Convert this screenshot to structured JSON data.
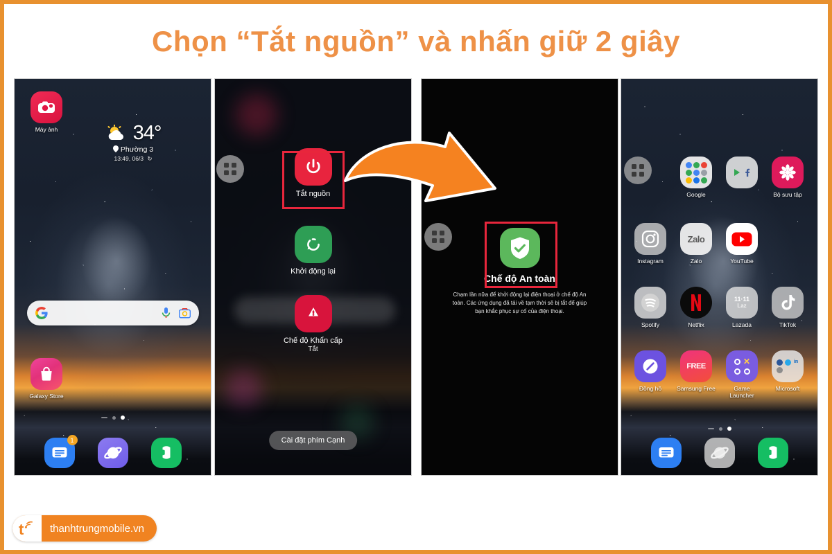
{
  "page": {
    "title": "Chọn “Tắt nguồn” và nhấn giữ 2 giây",
    "accent_color": "#EE9147",
    "frame_color": "#E8912F",
    "highlight_color": "#E8263C"
  },
  "watermark": {
    "text": "thanhtrungmobile.vn",
    "logo_letter": "t"
  },
  "arrow": {
    "name": "curved-arrow",
    "color": "#F58220",
    "outline": "#FFFFFF",
    "direction": "right-down"
  },
  "phone1": {
    "apps": [
      {
        "label": "Máy ảnh",
        "icon": "camera-icon"
      },
      {
        "label": "Galaxy Store",
        "icon": "galaxy-store-icon"
      }
    ],
    "weather": {
      "temperature": "34°",
      "place": "Phường 3",
      "time": "13:49, 06/3",
      "condition": "partly-cloudy"
    },
    "search": {
      "placeholder": "",
      "value": "",
      "engine": "google-icon",
      "mic": "microphone-icon",
      "lens": "camera-lens-icon"
    },
    "dock": [
      {
        "label": "Messages",
        "icon": "messages-icon",
        "badge": "1"
      },
      {
        "label": "Samsung Internet",
        "icon": "internet-icon",
        "badge": ""
      },
      {
        "label": "Phone",
        "icon": "phone-icon",
        "badge": ""
      }
    ]
  },
  "phone2": {
    "options": [
      {
        "label": "Tắt nguồn",
        "sub": "",
        "icon": "power-off-icon",
        "color": "#E8243E",
        "highlighted": true
      },
      {
        "label": "Khởi động lại",
        "sub": "",
        "icon": "restart-icon",
        "color": "#2E9E55",
        "highlighted": false
      },
      {
        "label": "Chế độ Khẩn cấp",
        "sub": "Tắt",
        "icon": "emergency-icon",
        "color": "#D8143C",
        "highlighted": false
      }
    ],
    "edge_button": "Cài đặt phím Cạnh",
    "drawer_icon": "app-drawer-icon"
  },
  "phone3": {
    "title": "Chế độ An toàn",
    "icon": "safe-mode-shield-icon",
    "icon_color": "#5CB85C",
    "highlighted": true,
    "body": "Chạm lần nữa để khởi động lại điện thoại ở chế độ An toàn. Các ứng dụng đã tải về tạm thời sẽ bị tắt để giúp bạn khắc phục sự cố của điện thoại.",
    "drawer_icon": "app-drawer-icon"
  },
  "phone4": {
    "drawer_icon": "app-drawer-icon",
    "apps": [
      {
        "label": "Google",
        "icon": "google-folder-icon"
      },
      {
        "label": "",
        "icon": "play-facebook-folder-icon"
      },
      {
        "label": "Bộ sưu tập",
        "icon": "gallery-icon"
      },
      {
        "label": "Instagram",
        "icon": "instagram-icon"
      },
      {
        "label": "Zalo",
        "icon": "zalo-icon"
      },
      {
        "label": "YouTube",
        "icon": "youtube-icon"
      },
      {
        "label": "Spotify",
        "icon": "spotify-icon"
      },
      {
        "label": "Netflix",
        "icon": "netflix-icon"
      },
      {
        "label": "Lazada",
        "icon": "lazada-icon"
      },
      {
        "label": "TikTok",
        "icon": "tiktok-icon"
      },
      {
        "label": "Đồng hồ",
        "icon": "clock-icon"
      },
      {
        "label": "Samsung Free",
        "icon": "samsung-free-icon"
      },
      {
        "label": "Game\nLauncher",
        "icon": "game-launcher-icon"
      },
      {
        "label": "Microsoft",
        "icon": "microsoft-folder-icon"
      }
    ],
    "dock": [
      {
        "label": "Messages",
        "icon": "messages-icon"
      },
      {
        "label": "Samsung Internet",
        "icon": "internet-icon"
      },
      {
        "label": "Phone",
        "icon": "phone-icon"
      }
    ],
    "page_dots": 3,
    "active_dot": 2
  }
}
